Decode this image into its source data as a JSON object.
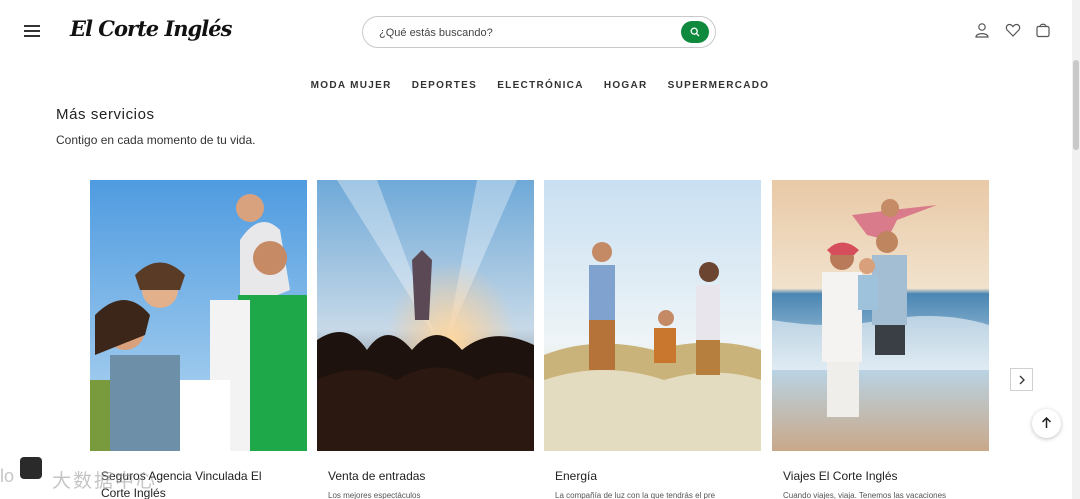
{
  "header": {
    "logo_text": "El Corte Inglés",
    "search_placeholder": "¿Qué estás buscando?"
  },
  "nav": {
    "items": [
      "MODA MUJER",
      "DEPORTES",
      "ELECTRÓNICA",
      "HOGAR",
      "SUPERMERCADO"
    ]
  },
  "section": {
    "title": "Más servicios",
    "subtitle": "Contigo en cada momento de tu vida."
  },
  "cards": [
    {
      "title": "Seguros Agencia Vinculada El Corte Inglés",
      "desc": ""
    },
    {
      "title": "Venta de entradas",
      "desc": "Los mejores espectáculos"
    },
    {
      "title": "Energía",
      "desc": "La compañía de luz con la que tendrás el pre"
    },
    {
      "title": "Viajes El Corte Inglés",
      "desc": "Cuando viajes, viaja. Tenemos las vacaciones"
    }
  ],
  "watermark": {
    "text": "大数据中心",
    "left": "lo"
  },
  "colors": {
    "accent_green": "#0f8a3d"
  }
}
